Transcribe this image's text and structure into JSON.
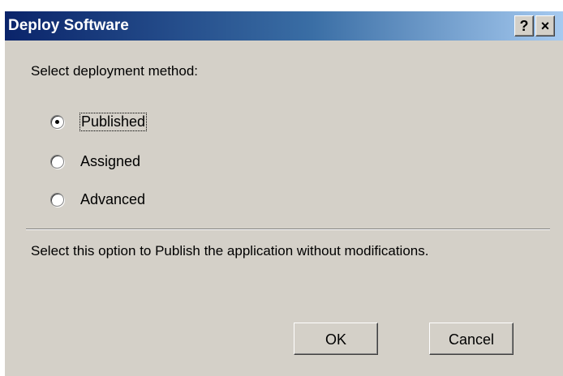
{
  "window": {
    "title": "Deploy Software",
    "help_glyph": "?",
    "close_glyph": "×"
  },
  "prompt": "Select deployment method:",
  "options": [
    {
      "label": "Published",
      "selected": true,
      "focused": true
    },
    {
      "label": "Assigned",
      "selected": false,
      "focused": false
    },
    {
      "label": "Advanced",
      "selected": false,
      "focused": false
    }
  ],
  "description": "Select this option to Publish the application without modifications.",
  "buttons": {
    "ok": "OK",
    "cancel": "Cancel"
  },
  "colors": {
    "face": "#d4d0c8",
    "title_start": "#0a246a",
    "title_end": "#a6caf0"
  }
}
